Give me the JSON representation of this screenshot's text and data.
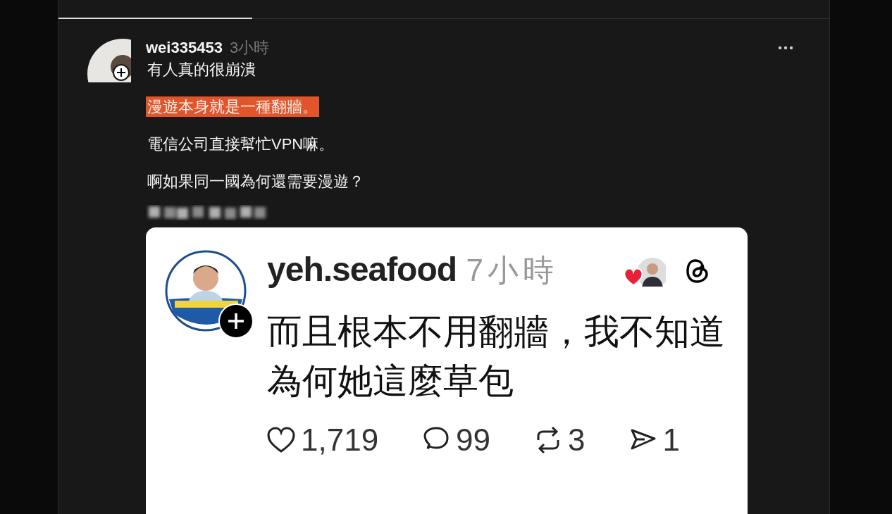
{
  "post": {
    "author": "wei335453",
    "time": "3小時",
    "lines": [
      {
        "text": "有人真的很崩潰",
        "highlighted": false
      },
      {
        "text": "漫遊本身就是一種翻牆。",
        "highlighted": true
      },
      {
        "text": "電信公司直接幫忙VPN嘛。",
        "highlighted": false
      },
      {
        "text": "啊如果同一國為何還需要漫遊？",
        "highlighted": false
      }
    ],
    "embed": {
      "author": "yeh.seafood",
      "time": "7小時",
      "liked": true,
      "text": "而且根本不用翻牆，我不知道為何她這麼草包",
      "stats": [
        {
          "kind": "like",
          "count": "1,719"
        },
        {
          "kind": "comment",
          "count": "99"
        },
        {
          "kind": "repost",
          "count": "3"
        },
        {
          "kind": "share",
          "count": "1"
        }
      ]
    }
  }
}
